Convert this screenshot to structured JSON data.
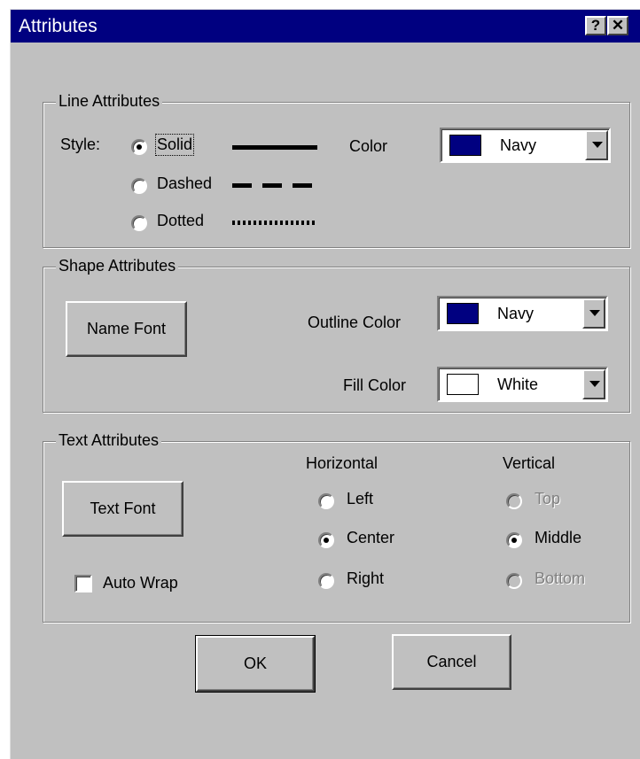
{
  "dialog": {
    "title": "Attributes",
    "help_button": "?",
    "close_button": "✕"
  },
  "line_attributes": {
    "legend": "Line Attributes",
    "style_label": "Style:",
    "options": [
      {
        "label": "Solid",
        "checked": true
      },
      {
        "label": "Dashed",
        "checked": false
      },
      {
        "label": "Dotted",
        "checked": false
      }
    ],
    "color_label": "Color",
    "color_value": "Navy",
    "color_hex": "#000080"
  },
  "shape_attributes": {
    "legend": "Shape Attributes",
    "name_font_button": "Name Font",
    "outline_color_label": "Outline Color",
    "outline_color_value": "Navy",
    "outline_color_hex": "#000080",
    "fill_color_label": "Fill Color",
    "fill_color_value": "White",
    "fill_color_hex": "#ffffff"
  },
  "text_attributes": {
    "legend": "Text Attributes",
    "text_font_button": "Text Font",
    "auto_wrap_label": "Auto Wrap",
    "auto_wrap_checked": false,
    "horizontal_label": "Horizontal",
    "horizontal_options": [
      {
        "label": "Left",
        "checked": false
      },
      {
        "label": "Center",
        "checked": true
      },
      {
        "label": "Right",
        "checked": false
      }
    ],
    "vertical_label": "Vertical",
    "vertical_options": [
      {
        "label": "Top",
        "checked": false,
        "disabled": true
      },
      {
        "label": "Middle",
        "checked": true,
        "disabled": false
      },
      {
        "label": "Bottom",
        "checked": false,
        "disabled": true
      }
    ]
  },
  "footer": {
    "ok_button": "OK",
    "cancel_button": "Cancel"
  }
}
